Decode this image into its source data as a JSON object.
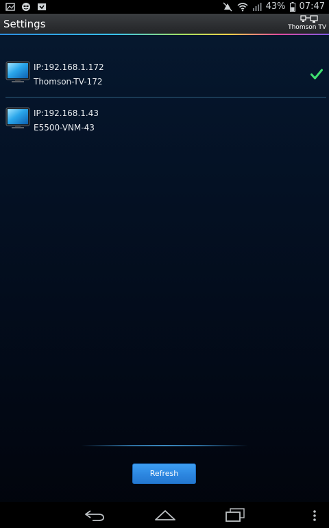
{
  "status_bar": {
    "left_icons": [
      "picture-icon",
      "face-icon",
      "download-icon"
    ],
    "battery_text": "43%",
    "time": "07:47",
    "right_icons": [
      "mute-icon",
      "wifi-icon",
      "signal-icon",
      "battery-icon"
    ]
  },
  "action_bar": {
    "title": "Settings",
    "tv_switch_label": "Thomson TV",
    "tv_switch_icon": "tv-connect-icon"
  },
  "devices": [
    {
      "ip": "IP:192.168.1.172",
      "name": "Thomson-TV-172",
      "selected": true,
      "icon": "tv-icon"
    },
    {
      "ip": "IP:192.168.1.43",
      "name": "E5500-VNM-43",
      "selected": false,
      "icon": "tv-icon"
    }
  ],
  "refresh_button": {
    "label": "Refresh"
  },
  "nav_bar": {
    "icons": [
      "back-icon",
      "home-icon",
      "recents-icon",
      "menu-icon"
    ]
  },
  "colors": {
    "accent": "#2c86e0",
    "check": "#3fe070",
    "background": "#051429"
  }
}
